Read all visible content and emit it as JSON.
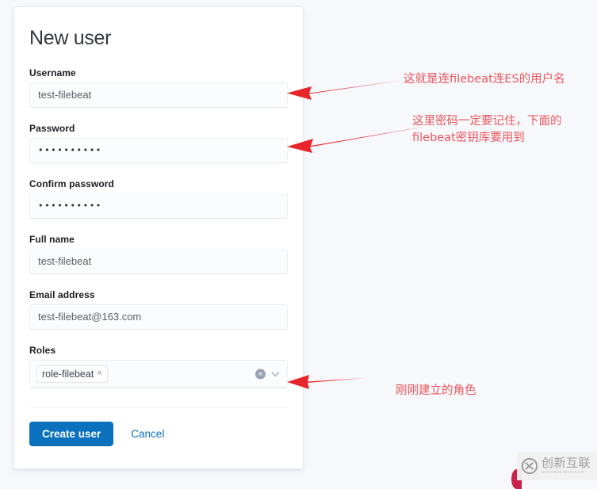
{
  "form": {
    "title": "New user",
    "fields": [
      {
        "label": "Username",
        "value": "test-filebeat",
        "type": "text",
        "name": "username"
      },
      {
        "label": "Password",
        "value": "••••••••••",
        "type": "password",
        "name": "password"
      },
      {
        "label": "Confirm password",
        "value": "••••••••••",
        "type": "password",
        "name": "confirm-password"
      },
      {
        "label": "Full name",
        "value": "test-filebeat",
        "type": "text",
        "name": "full-name"
      },
      {
        "label": "Email address",
        "value": "test-filebeat@163.com",
        "type": "text",
        "name": "email-address"
      }
    ],
    "roles": {
      "label": "Roles",
      "selected": "role-filebeat",
      "pill_remove_glyph": "×",
      "clear_glyph": "✕",
      "clear_icon_name": "clear-selection-icon",
      "chevron_icon_name": "chevron-down-icon"
    },
    "actions": {
      "submit_label": "Create user",
      "cancel_label": "Cancel"
    }
  },
  "annotations": [
    {
      "name": "annotation-username",
      "text": "这就是连filebeat连ES的用户名"
    },
    {
      "name": "annotation-password",
      "text": "这里密码一定要记住，下面的\nfilebeat密钥库要用到"
    },
    {
      "name": "annotation-roles",
      "text": "刚刚建立的角色"
    }
  ],
  "watermark": {
    "cn": "创新互联",
    "en": "CHUANGXIN HULIAN",
    "logo_icon_name": "cx-logo-icon"
  },
  "colors": {
    "accent": "#0b71bd",
    "annotation": "#e8565b",
    "arrow": "#e8252a",
    "page_bg": "#f7f8fc",
    "card_bg": "#ffffff",
    "field_bg": "#fbfcfd"
  }
}
